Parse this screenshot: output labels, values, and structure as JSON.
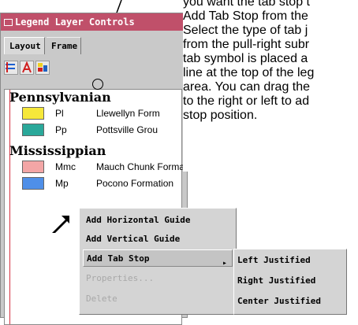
{
  "window": {
    "title": "Legend Layer Controls",
    "tabs": [
      "Layout",
      "Frame"
    ],
    "toolbar_icons": [
      "add-guide-icon",
      "text-color-icon",
      "color-layers-icon"
    ]
  },
  "legend": {
    "groups": [
      {
        "name": "Pennsylvanian",
        "items": [
          {
            "code": "Pl",
            "desc": "Llewellyn Form",
            "color": "#f6e83a"
          },
          {
            "code": "Pp",
            "desc": "Pottsville Grou",
            "color": "#2aa89a"
          }
        ]
      },
      {
        "name": "Mississippian",
        "items": [
          {
            "code": "Mmc",
            "desc": "Mauch Chunk Formation",
            "color": "#f3a6a6"
          },
          {
            "code": "Mp",
            "desc": "Pocono Formation",
            "color": "#4f8fe8"
          }
        ]
      }
    ],
    "guide_color": "#d43040"
  },
  "callout": {
    "lines": [
      "you want the tab stop t",
      "Add Tab Stop from the",
      "Select the type of tab j",
      "from the pull-right subr",
      "tab symbol is placed a",
      "line at the top of the leg",
      "area.  You can drag the",
      "to the right or left to ad",
      "stop position."
    ]
  },
  "context_menu": {
    "items": [
      {
        "label": "Add Horizontal Guide",
        "enabled": true
      },
      {
        "label": "Add Vertical Guide",
        "enabled": true
      },
      {
        "label": "Add Tab Stop",
        "enabled": true,
        "submenu": true
      },
      {
        "label": "Properties...",
        "enabled": false
      },
      {
        "label": "Delete",
        "enabled": false
      }
    ],
    "submenu": [
      "Left Justified",
      "Right Justified",
      "Center Justified"
    ]
  }
}
